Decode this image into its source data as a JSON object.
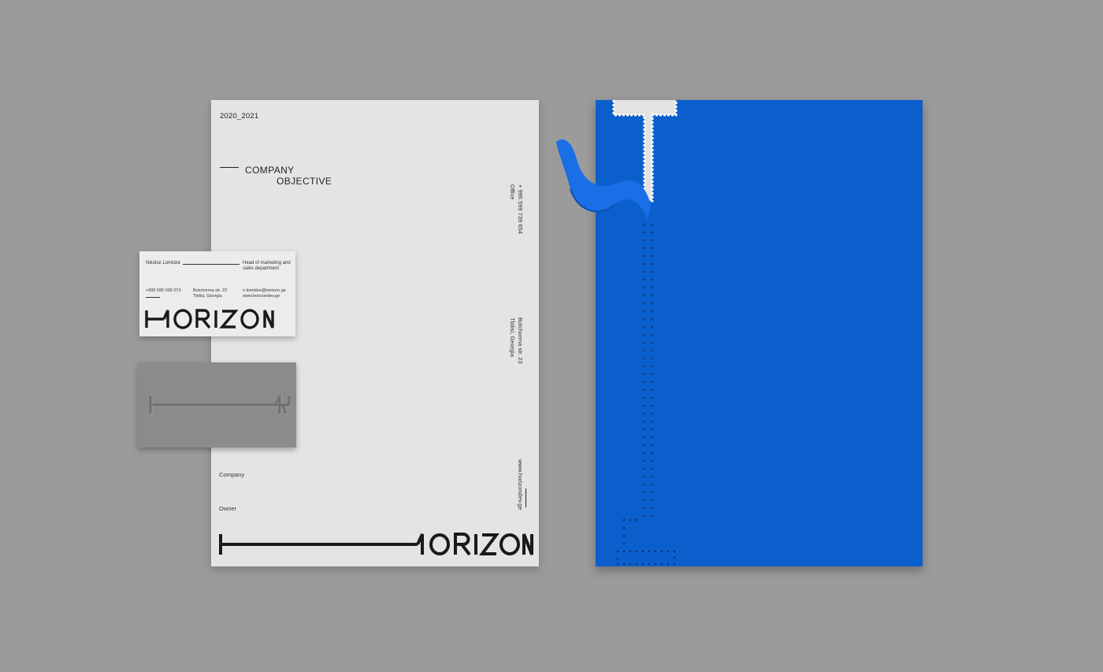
{
  "letterhead": {
    "year": "2020_2021",
    "objective_line1": "COMPANY",
    "objective_line2": "OBJECTIVE",
    "phone": "+ 995 599 739 654",
    "phone_label": "Office",
    "address_line1": "Botchorma str. 23",
    "address_line2": "Tbilisi, Georgia",
    "website": "www.horizondev.ge",
    "company_label": "Company",
    "owner_label": "Owner",
    "logo_text": "HORIZON"
  },
  "business_card": {
    "name": "Nikoloz Lomidze",
    "title_line1": "Head of marketing and",
    "title_line2": "sales department",
    "phone": "+995 595 036 073",
    "address_line1": "Botchorma str. 23",
    "address_line2": "Tbilisi, Georgia",
    "email": "n.lomidze@horizon.ge",
    "website": "www.horizondev.ge",
    "logo_text": "HORIZON"
  },
  "colors": {
    "background": "#9b9b9b",
    "paper": "#e4e4e4",
    "folder_blue": "#0a5fcd",
    "ink": "#1a1a1a"
  }
}
